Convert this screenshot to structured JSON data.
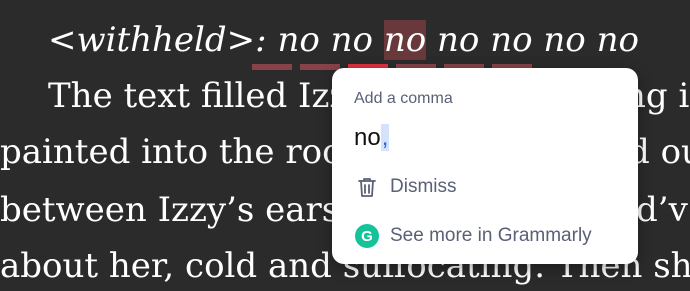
{
  "document": {
    "line1_prefix": "<withheld>: ",
    "repeated_word": "no",
    "line2": "The text filled Izzy",
    "line2_tail": "ng i",
    "line3": "painted into the roo",
    "line3_tail": "d ou",
    "line4": "between Izzy’s ears",
    "line4_tail": "d’v",
    "line5": "about her, cold and suffocating. Then she"
  },
  "popup": {
    "title": "Add a comma",
    "suggestion_word": "no",
    "suggestion_punct": ",",
    "dismiss_label": "Dismiss",
    "more_label": "See more in Grammarly",
    "logo_letter": "G",
    "brand_color": "#15c39a"
  }
}
